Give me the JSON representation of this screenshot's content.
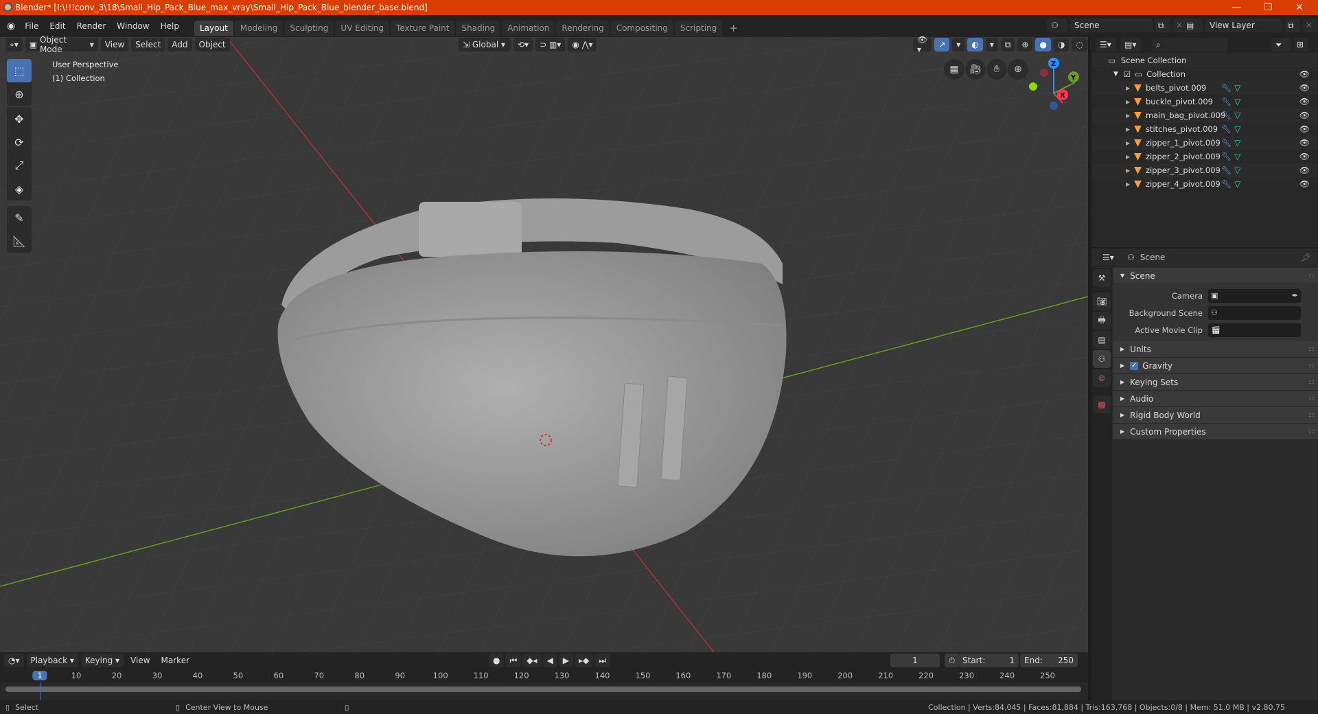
{
  "window": {
    "title": "Blender* [I:\\!!!conv_3\\18\\Small_Hip_Pack_Blue_max_vray\\Small_Hip_Pack_Blue_blender_base.blend]",
    "controls": {
      "minimize": "—",
      "maximize": "❐",
      "close": "✕"
    }
  },
  "menu": [
    "File",
    "Edit",
    "Render",
    "Window",
    "Help"
  ],
  "workspaces": [
    {
      "label": "Layout",
      "active": true
    },
    {
      "label": "Modeling"
    },
    {
      "label": "Sculpting"
    },
    {
      "label": "UV Editing"
    },
    {
      "label": "Texture Paint"
    },
    {
      "label": "Shading"
    },
    {
      "label": "Animation"
    },
    {
      "label": "Rendering"
    },
    {
      "label": "Compositing"
    },
    {
      "label": "Scripting"
    }
  ],
  "add_workspace": "+",
  "scene_selector": {
    "value": "Scene"
  },
  "view_layer_selector": {
    "value": "View Layer"
  },
  "viewport_header": {
    "mode": "Object Mode",
    "menus": [
      "View",
      "Select",
      "Add",
      "Object"
    ],
    "orientation": "Global"
  },
  "viewport": {
    "overlay_line1": "User Perspective",
    "overlay_line2": "(1) Collection",
    "gizmo": {
      "z": "Z",
      "y": "Y",
      "x": "X",
      "x_color": "#ff3352",
      "y_color": "#8bdc00",
      "z_color": "#2890ff"
    }
  },
  "tools": [
    "select-box",
    "cursor",
    "move",
    "rotate",
    "scale",
    "transform",
    "annotate",
    "measure"
  ],
  "outliner": {
    "root": "Scene Collection",
    "collection": "Collection",
    "objects": [
      "belts_pivot.009",
      "buckle_pivot.009",
      "main_bag_pivot.009",
      "stitches_pivot.009",
      "zipper_1_pivot.009",
      "zipper_2_pivot.009",
      "zipper_3_pivot.009",
      "zipper_4_pivot.009"
    ]
  },
  "properties": {
    "context": "Scene",
    "panel_title": "Scene",
    "fields": [
      {
        "label": "Camera",
        "value": ""
      },
      {
        "label": "Background Scene",
        "value": ""
      },
      {
        "label": "Active Movie Clip",
        "value": ""
      }
    ],
    "sections": [
      {
        "label": "Units"
      },
      {
        "label": "Gravity",
        "checkbox": true
      },
      {
        "label": "Keying Sets"
      },
      {
        "label": "Audio"
      },
      {
        "label": "Rigid Body World"
      },
      {
        "label": "Custom Properties"
      }
    ]
  },
  "timeline": {
    "menus": [
      "Playback",
      "Keying",
      "View",
      "Marker"
    ],
    "current_frame": "1",
    "start_label": "Start:",
    "start": "1",
    "end_label": "End:",
    "end": "250",
    "ticks": [
      "1",
      "10",
      "20",
      "30",
      "40",
      "50",
      "60",
      "70",
      "80",
      "90",
      "100",
      "110",
      "120",
      "130",
      "140",
      "150",
      "160",
      "170",
      "180",
      "190",
      "200",
      "210",
      "220",
      "230",
      "240",
      "250"
    ]
  },
  "statusbar": {
    "left_action": "Select",
    "middle_action": "Center View to Mouse",
    "stats": "Collection | Verts:84,045 | Faces:81,884 | Tris:163,768 | Objects:0/8 | Mem: 51.0 MB | v2.80.75"
  }
}
